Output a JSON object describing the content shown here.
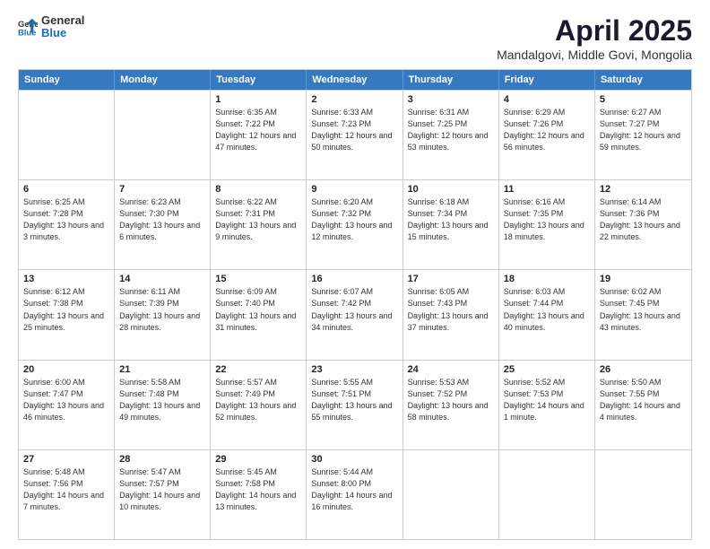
{
  "header": {
    "logo_line1": "General",
    "logo_line2": "Blue",
    "main_title": "April 2025",
    "subtitle": "Mandalgovi, Middle Govi, Mongolia"
  },
  "days_of_week": [
    "Sunday",
    "Monday",
    "Tuesday",
    "Wednesday",
    "Thursday",
    "Friday",
    "Saturday"
  ],
  "weeks": [
    [
      {
        "day": "",
        "info": ""
      },
      {
        "day": "",
        "info": ""
      },
      {
        "day": "1",
        "info": "Sunrise: 6:35 AM\nSunset: 7:22 PM\nDaylight: 12 hours and 47 minutes."
      },
      {
        "day": "2",
        "info": "Sunrise: 6:33 AM\nSunset: 7:23 PM\nDaylight: 12 hours and 50 minutes."
      },
      {
        "day": "3",
        "info": "Sunrise: 6:31 AM\nSunset: 7:25 PM\nDaylight: 12 hours and 53 minutes."
      },
      {
        "day": "4",
        "info": "Sunrise: 6:29 AM\nSunset: 7:26 PM\nDaylight: 12 hours and 56 minutes."
      },
      {
        "day": "5",
        "info": "Sunrise: 6:27 AM\nSunset: 7:27 PM\nDaylight: 12 hours and 59 minutes."
      }
    ],
    [
      {
        "day": "6",
        "info": "Sunrise: 6:25 AM\nSunset: 7:28 PM\nDaylight: 13 hours and 3 minutes."
      },
      {
        "day": "7",
        "info": "Sunrise: 6:23 AM\nSunset: 7:30 PM\nDaylight: 13 hours and 6 minutes."
      },
      {
        "day": "8",
        "info": "Sunrise: 6:22 AM\nSunset: 7:31 PM\nDaylight: 13 hours and 9 minutes."
      },
      {
        "day": "9",
        "info": "Sunrise: 6:20 AM\nSunset: 7:32 PM\nDaylight: 13 hours and 12 minutes."
      },
      {
        "day": "10",
        "info": "Sunrise: 6:18 AM\nSunset: 7:34 PM\nDaylight: 13 hours and 15 minutes."
      },
      {
        "day": "11",
        "info": "Sunrise: 6:16 AM\nSunset: 7:35 PM\nDaylight: 13 hours and 18 minutes."
      },
      {
        "day": "12",
        "info": "Sunrise: 6:14 AM\nSunset: 7:36 PM\nDaylight: 13 hours and 22 minutes."
      }
    ],
    [
      {
        "day": "13",
        "info": "Sunrise: 6:12 AM\nSunset: 7:38 PM\nDaylight: 13 hours and 25 minutes."
      },
      {
        "day": "14",
        "info": "Sunrise: 6:11 AM\nSunset: 7:39 PM\nDaylight: 13 hours and 28 minutes."
      },
      {
        "day": "15",
        "info": "Sunrise: 6:09 AM\nSunset: 7:40 PM\nDaylight: 13 hours and 31 minutes."
      },
      {
        "day": "16",
        "info": "Sunrise: 6:07 AM\nSunset: 7:42 PM\nDaylight: 13 hours and 34 minutes."
      },
      {
        "day": "17",
        "info": "Sunrise: 6:05 AM\nSunset: 7:43 PM\nDaylight: 13 hours and 37 minutes."
      },
      {
        "day": "18",
        "info": "Sunrise: 6:03 AM\nSunset: 7:44 PM\nDaylight: 13 hours and 40 minutes."
      },
      {
        "day": "19",
        "info": "Sunrise: 6:02 AM\nSunset: 7:45 PM\nDaylight: 13 hours and 43 minutes."
      }
    ],
    [
      {
        "day": "20",
        "info": "Sunrise: 6:00 AM\nSunset: 7:47 PM\nDaylight: 13 hours and 46 minutes."
      },
      {
        "day": "21",
        "info": "Sunrise: 5:58 AM\nSunset: 7:48 PM\nDaylight: 13 hours and 49 minutes."
      },
      {
        "day": "22",
        "info": "Sunrise: 5:57 AM\nSunset: 7:49 PM\nDaylight: 13 hours and 52 minutes."
      },
      {
        "day": "23",
        "info": "Sunrise: 5:55 AM\nSunset: 7:51 PM\nDaylight: 13 hours and 55 minutes."
      },
      {
        "day": "24",
        "info": "Sunrise: 5:53 AM\nSunset: 7:52 PM\nDaylight: 13 hours and 58 minutes."
      },
      {
        "day": "25",
        "info": "Sunrise: 5:52 AM\nSunset: 7:53 PM\nDaylight: 14 hours and 1 minute."
      },
      {
        "day": "26",
        "info": "Sunrise: 5:50 AM\nSunset: 7:55 PM\nDaylight: 14 hours and 4 minutes."
      }
    ],
    [
      {
        "day": "27",
        "info": "Sunrise: 5:48 AM\nSunset: 7:56 PM\nDaylight: 14 hours and 7 minutes."
      },
      {
        "day": "28",
        "info": "Sunrise: 5:47 AM\nSunset: 7:57 PM\nDaylight: 14 hours and 10 minutes."
      },
      {
        "day": "29",
        "info": "Sunrise: 5:45 AM\nSunset: 7:58 PM\nDaylight: 14 hours and 13 minutes."
      },
      {
        "day": "30",
        "info": "Sunrise: 5:44 AM\nSunset: 8:00 PM\nDaylight: 14 hours and 16 minutes."
      },
      {
        "day": "",
        "info": ""
      },
      {
        "day": "",
        "info": ""
      },
      {
        "day": "",
        "info": ""
      }
    ]
  ]
}
